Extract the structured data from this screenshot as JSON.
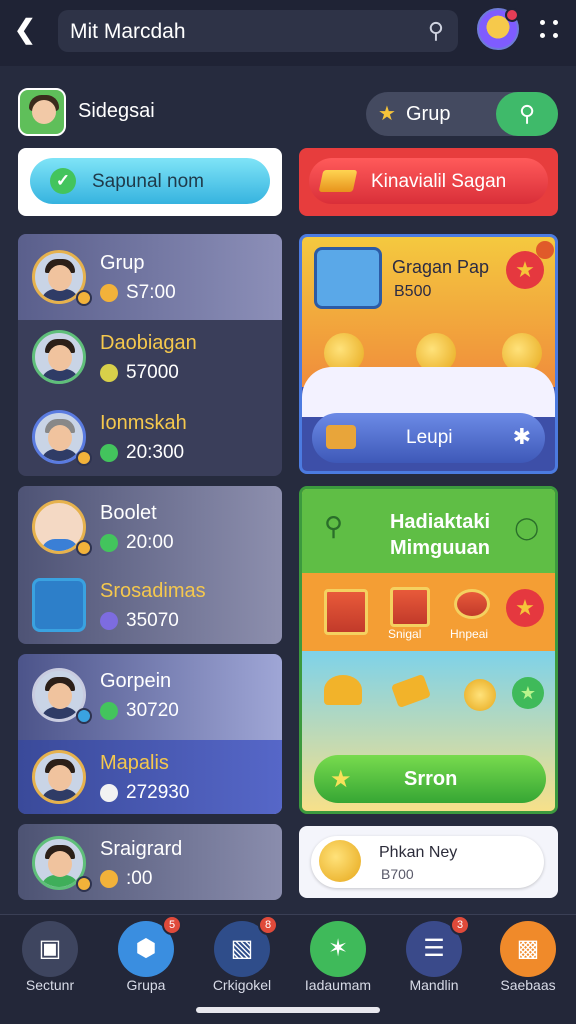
{
  "header": {
    "back_icon": "chevron-left-icon",
    "search_text": "Mit Marcdah",
    "search_icon": "search-icon",
    "more_icon": "more-dots-icon"
  },
  "profile": {
    "name": "Sidegsai",
    "group_pill_label": "Grup"
  },
  "action_buttons": {
    "left_label": "Sapunal nom",
    "right_label": "Kinavialil Sagan"
  },
  "list1": [
    {
      "title": "Grup",
      "value": "S7:00"
    },
    {
      "title": "Daobiagan",
      "value": "57000"
    },
    {
      "title": "Ionmskah",
      "value": "20:300"
    }
  ],
  "list2": [
    {
      "title": "Boolet",
      "value": "20:00"
    },
    {
      "title": "Srosadimas",
      "value": "35070"
    }
  ],
  "list3": [
    {
      "title": "Gorpein",
      "value": "30720"
    },
    {
      "title": "Mapalis",
      "value": "272930"
    }
  ],
  "list4": [
    {
      "title": "Sraigrard",
      "value": ":00"
    }
  ],
  "promo": {
    "title": "Gragan Pap",
    "value": "B500",
    "button_label": "Leupi"
  },
  "reward": {
    "title": "Hadiaktaki Mimguuan",
    "gift_label_1": "Snigal",
    "gift_label_2": "Hnpeai",
    "button_label": "Srron"
  },
  "daily": {
    "title": "Phkan Ney",
    "value": "B700"
  },
  "bottom_nav": [
    {
      "label": "Sectunr",
      "icon": "basket-icon",
      "badge": ""
    },
    {
      "label": "Grupa",
      "icon": "hexagon-icon",
      "badge": "5"
    },
    {
      "label": "Crkigokel",
      "icon": "card-icon",
      "badge": "8"
    },
    {
      "label": "Iadaumam",
      "icon": "star-burst-icon",
      "badge": ""
    },
    {
      "label": "Mandlin",
      "icon": "list-icon",
      "badge": "3"
    },
    {
      "label": "Saebaas",
      "icon": "gift-box-icon",
      "badge": ""
    }
  ],
  "colors": {
    "accent_green": "#3fba6a",
    "accent_red": "#e73d3d",
    "gold": "#f5c84d",
    "background": "#262b3e"
  }
}
